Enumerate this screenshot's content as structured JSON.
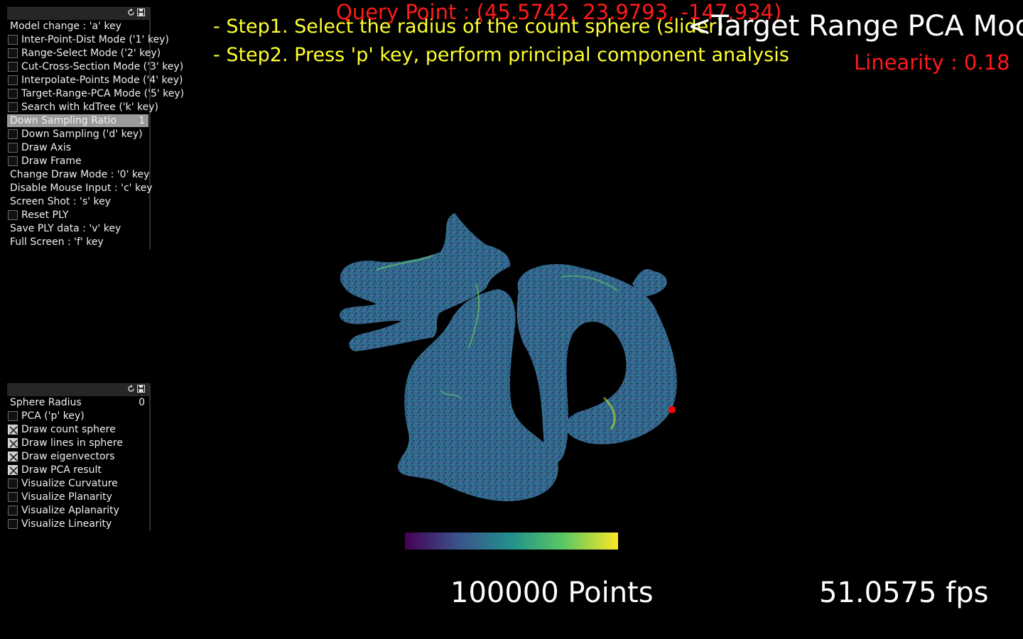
{
  "overlay": {
    "query_point": "Query Point : (45.5742, 23.9793, -147.934)",
    "step1": "- Step1. Select the radius of the count sphere (slider)",
    "step2": "- Step2. Press 'p' key, perform principal component analysis",
    "mode_title": "<Target Range PCA Mode>",
    "linearity": "Linearity : 0.18",
    "points_count": "100000 Points",
    "fps": "51.0575 fps"
  },
  "colors": {
    "step_text": "#ffff2e",
    "alert_text": "#ff1a1a",
    "query_marker": "#ff0000",
    "colormap": [
      "#440154",
      "#3b528b",
      "#21918c",
      "#5ec962",
      "#fde725"
    ]
  },
  "main_panel": {
    "titlebar_icons": [
      "refresh-icon",
      "save-icon"
    ],
    "model_change": "Model change : 'a' key",
    "inter_point_dist": "Inter-Point-Dist Mode ('1' key)",
    "range_select": "Range-Select Mode ('2' key)",
    "cut_cross_section": "Cut-Cross-Section Mode ('3' key)",
    "interpolate_points": "Interpolate-Points Mode ('4' key)",
    "target_range_pca": "Target-Range-PCA Mode ('5' key)",
    "search_kdtree": "Search with kdTree ('k' key)",
    "down_sampling_ratio_label": "Down Sampling Ratio",
    "down_sampling_ratio_value": "1",
    "down_sampling": "Down Sampling ('d' key)",
    "draw_axis": "Draw Axis",
    "draw_frame": "Draw Frame",
    "change_draw_mode": "Change Draw Mode : '0' key",
    "disable_mouse": "Disable Mouse Input : 'c' key",
    "screen_shot": "Screen Shot : 's' key",
    "reset_ply": "Reset PLY",
    "save_ply": "Save PLY data : 'v' key",
    "full_screen": "Full Screen : 'f' key"
  },
  "pca_panel": {
    "titlebar_icons": [
      "refresh-icon",
      "save-icon"
    ],
    "sphere_radius_label": "Sphere Radius",
    "sphere_radius_value": "0",
    "pca": "PCA ('p' key)",
    "draw_count_sphere": "Draw count sphere",
    "draw_lines_in_sphere": "Draw lines in sphere",
    "draw_eigenvectors": "Draw eigenvectors",
    "draw_pca_result": "Draw PCA result",
    "visualize_curvature": "Visualize Curvature",
    "visualize_planarity": "Visualize Planarity",
    "visualize_aplanarity": "Visualize Aplanarity",
    "visualize_linearity": "Visualize Linearity"
  }
}
